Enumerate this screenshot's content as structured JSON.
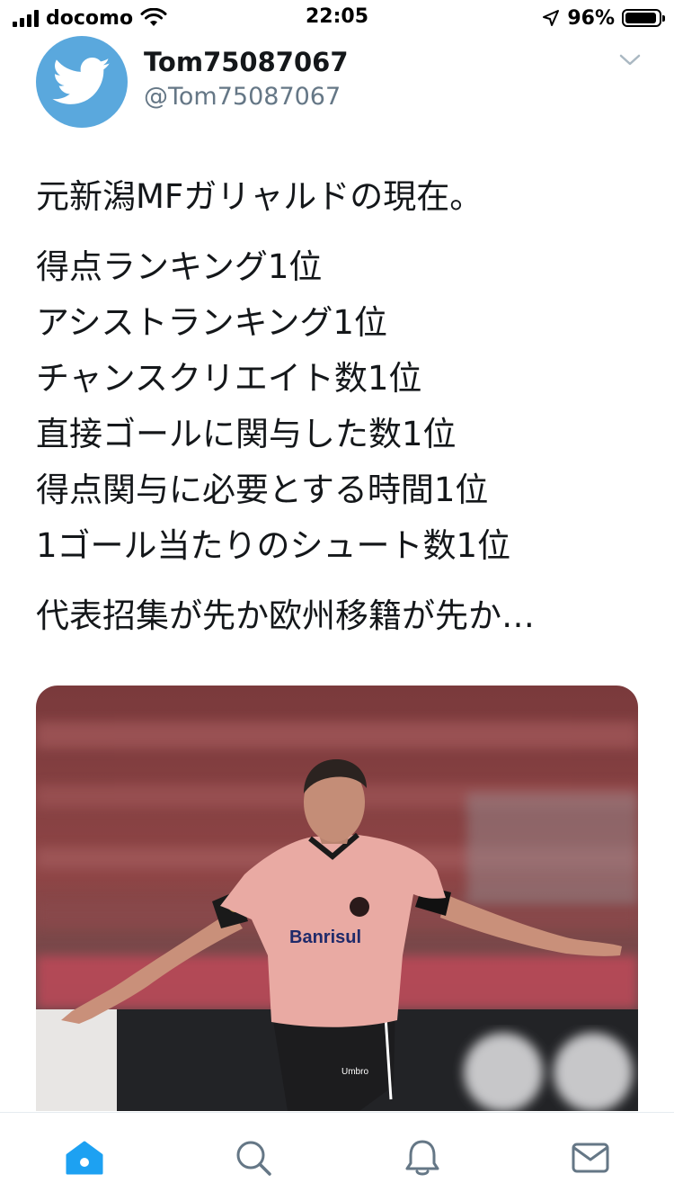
{
  "status_bar": {
    "carrier": "docomo",
    "time": "22:05",
    "battery_percent": "96%",
    "battery_level": 0.96
  },
  "tweet": {
    "display_name": "Tom75087067",
    "handle": "@Tom75087067",
    "text_lines": [
      "元新潟MFガリャルドの現在。",
      "得点ランキング1位",
      "アシストランキング1位",
      "チャンスクリエイト数1位",
      "直接ゴールに関与した数1位",
      "得点関与に必要とする時間1位",
      "1ゴール当たりのシュート数1位",
      "代表招集が先か欧州移籍が先か…"
    ],
    "media": {
      "shirt_sponsor": "Banrisul",
      "shorts_brand": "Umbro"
    }
  },
  "tabbar": {
    "tabs": [
      {
        "icon": "home-icon",
        "active": true
      },
      {
        "icon": "search-icon",
        "active": false
      },
      {
        "icon": "notifications-icon",
        "active": false
      },
      {
        "icon": "messages-icon",
        "active": false
      }
    ],
    "accent_color": "#1da1f2"
  },
  "colors": {
    "avatar_bg": "#5aa8dd",
    "secondary_text": "#657786"
  }
}
